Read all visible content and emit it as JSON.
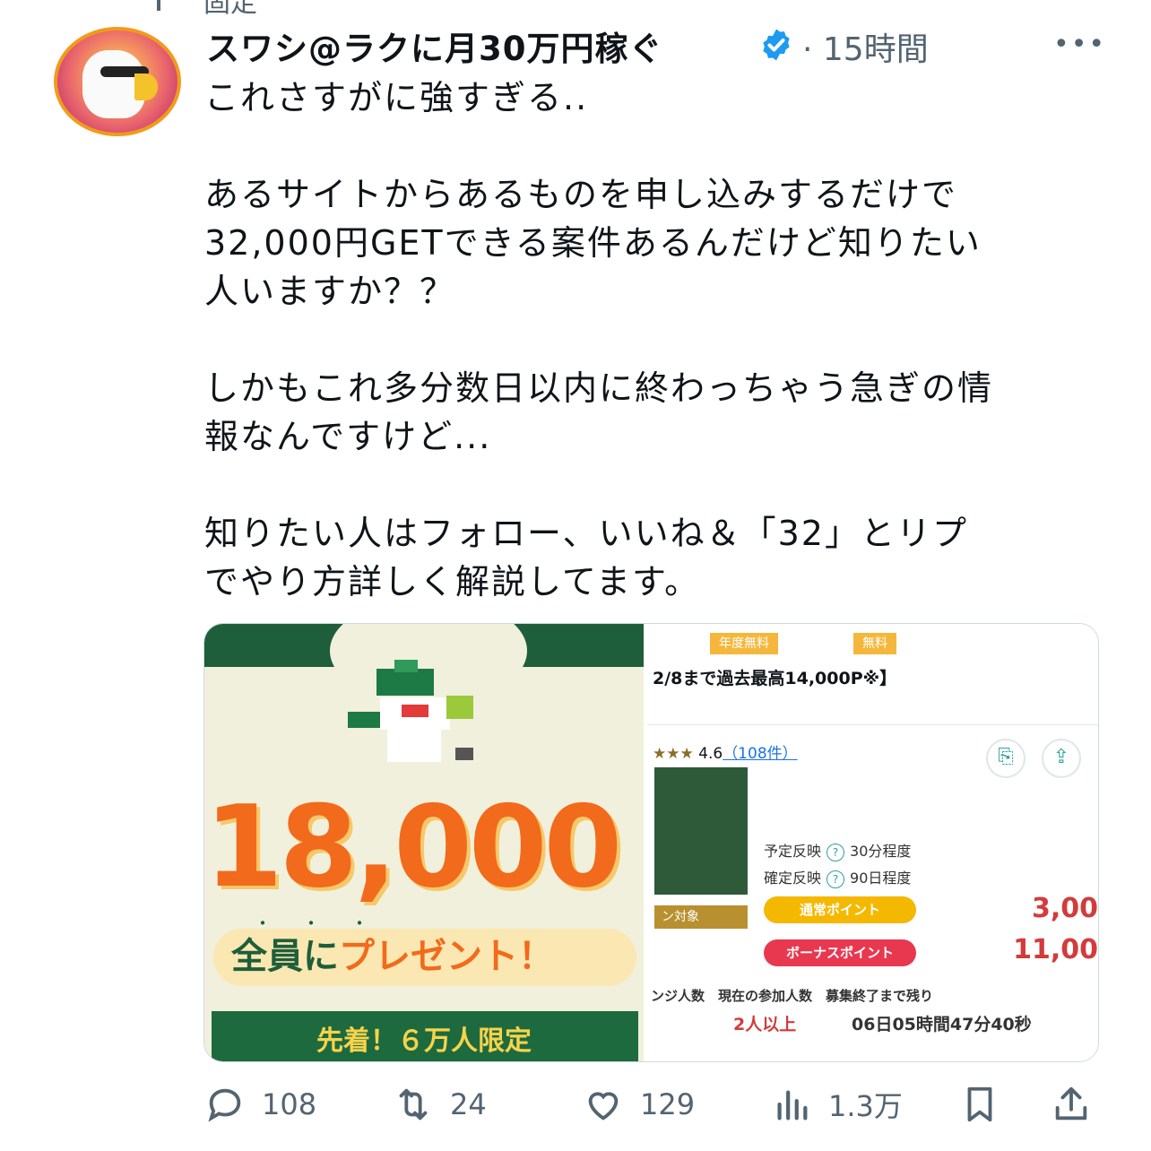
{
  "pinned_label": "固定",
  "author": {
    "display_name": "スワシ@ラクに月30万円稼ぐ",
    "timestamp": "15時間"
  },
  "more_label": "•••",
  "tweet": {
    "paragraphs": [
      "これさすがに強すぎる..",
      "あるサイトからあるものを申し込みするだけで\n32,000円GETできる案件あるんだけど知りたい\n人いますか？？",
      "しかもこれ多分数日以内に終わっちゃう急ぎの情\n報なんですけど...",
      "知りたい人はフォロー、いいね＆「32」とリプ\nでやり方詳しく解説してます。"
    ]
  },
  "media": {
    "left": {
      "amount": "18,000",
      "dots": "・・・",
      "present_part1": "全員に",
      "present_part2": "プレゼント！",
      "ribbon": "先着！６万人限定"
    },
    "right": {
      "tag1": "年度無料",
      "tag2": "無料",
      "headline": "2/8まで過去最高14,000P※】",
      "stars": "★★★",
      "rating": "4.6",
      "review_count": "（108件）",
      "row1_label": "予定反映",
      "row1_value": "30分程度",
      "row2_label": "確定反映",
      "row2_value": "90日程度",
      "target_label": "ン対象",
      "normal_point_label": "通常ポイント",
      "normal_point_value": "3,00",
      "bonus_point_label": "ボーナスポイント",
      "bonus_point_value": "11,00",
      "stats_labels": "ンジ人数　現在の参加人数　募集終了まで残り",
      "current_participants": "2人以上",
      "remaining_time": "06日05時間47分40秒"
    }
  },
  "actions": {
    "replies": "108",
    "retweets": "24",
    "likes": "129",
    "views": "1.3万"
  },
  "colors": {
    "verified": "#1d9bf0",
    "secondary_text": "#536471",
    "accent_orange": "#f26a1b",
    "banner_green": "#1e5e3a"
  }
}
